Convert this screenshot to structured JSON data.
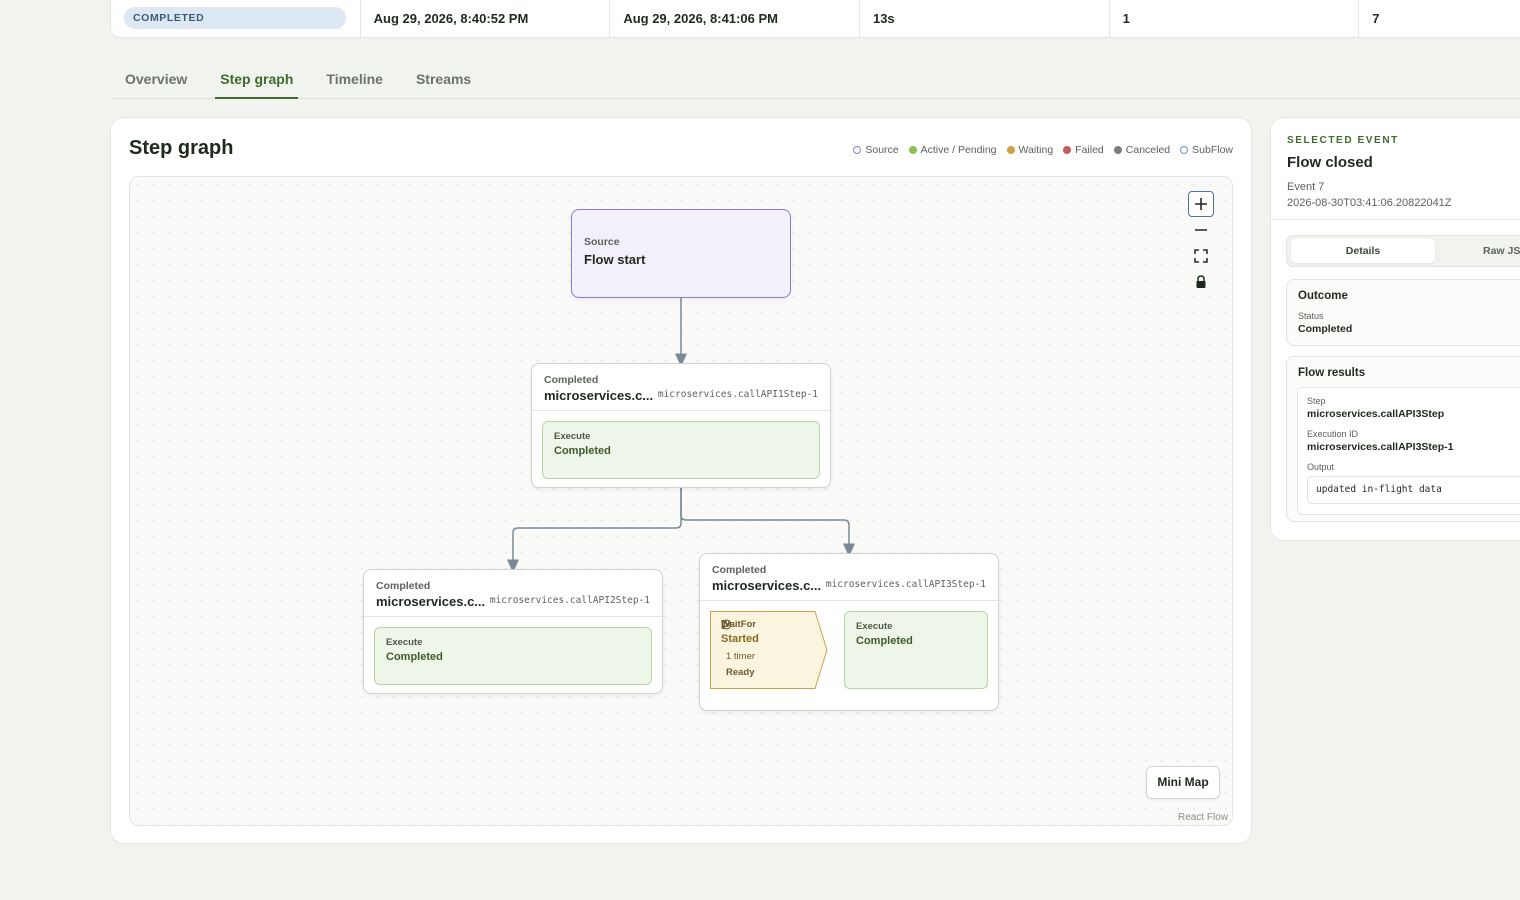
{
  "summary": {
    "status": "COMPLETED",
    "started": "Aug 29, 2026, 8:40:52 PM",
    "ended": "Aug 29, 2026, 8:41:06 PM",
    "duration": "13s",
    "count_a": "1",
    "count_b": "7"
  },
  "tabs": [
    {
      "label": "Overview",
      "active": false
    },
    {
      "label": "Step graph",
      "active": true
    },
    {
      "label": "Timeline",
      "active": false
    },
    {
      "label": "Streams",
      "active": false
    }
  ],
  "graph": {
    "title": "Step graph",
    "legend": [
      {
        "label": "Source",
        "color": "#8b7bd8"
      },
      {
        "label": "Active / Pending",
        "color": "#8cc152"
      },
      {
        "label": "Waiting",
        "color": "#d0a04a"
      },
      {
        "label": "Failed",
        "color": "#c45b5b"
      },
      {
        "label": "Canceled",
        "color": "#7c7f7a"
      },
      {
        "label": "SubFlow",
        "color": "#6d8fd6"
      }
    ],
    "source_node": {
      "kind": "Source",
      "name": "Flow start"
    },
    "step1": {
      "status": "Completed",
      "name": "microservices.c...",
      "id": "microservices.callAPI1Step-1",
      "exec_label": "Execute",
      "exec_status": "Completed"
    },
    "step2": {
      "status": "Completed",
      "name": "microservices.c...",
      "id": "microservices.callAPI2Step-1",
      "exec_label": "Execute",
      "exec_status": "Completed"
    },
    "step3": {
      "status": "Completed",
      "name": "microservices.c...",
      "id": "microservices.callAPI3Step-1",
      "wait_label": "WaitFor",
      "wait_status": "Started",
      "wait_timer": "1 timer",
      "wait_ready": "Ready",
      "exec_label": "Execute",
      "exec_status": "Completed"
    },
    "minimap_label": "Mini Map",
    "attribution": "React Flow"
  },
  "side": {
    "eyebrow": "SELECTED EVENT",
    "title": "Flow closed",
    "event_num": "Event 7",
    "timestamp": "2026-08-30T03:41:06.20822041Z",
    "tab_details": "Details",
    "tab_raw": "Raw JS",
    "outcome": {
      "title": "Outcome",
      "status_label": "Status",
      "status_value": "Completed"
    },
    "results": {
      "title": "Flow results",
      "step_label": "Step",
      "step_value": "microservices.callAPI3Step",
      "exec_id_label": "Execution ID",
      "exec_id_value": "microservices.callAPI3Step-1",
      "output_label": "Output",
      "output_value": "updated in-flight data"
    }
  }
}
